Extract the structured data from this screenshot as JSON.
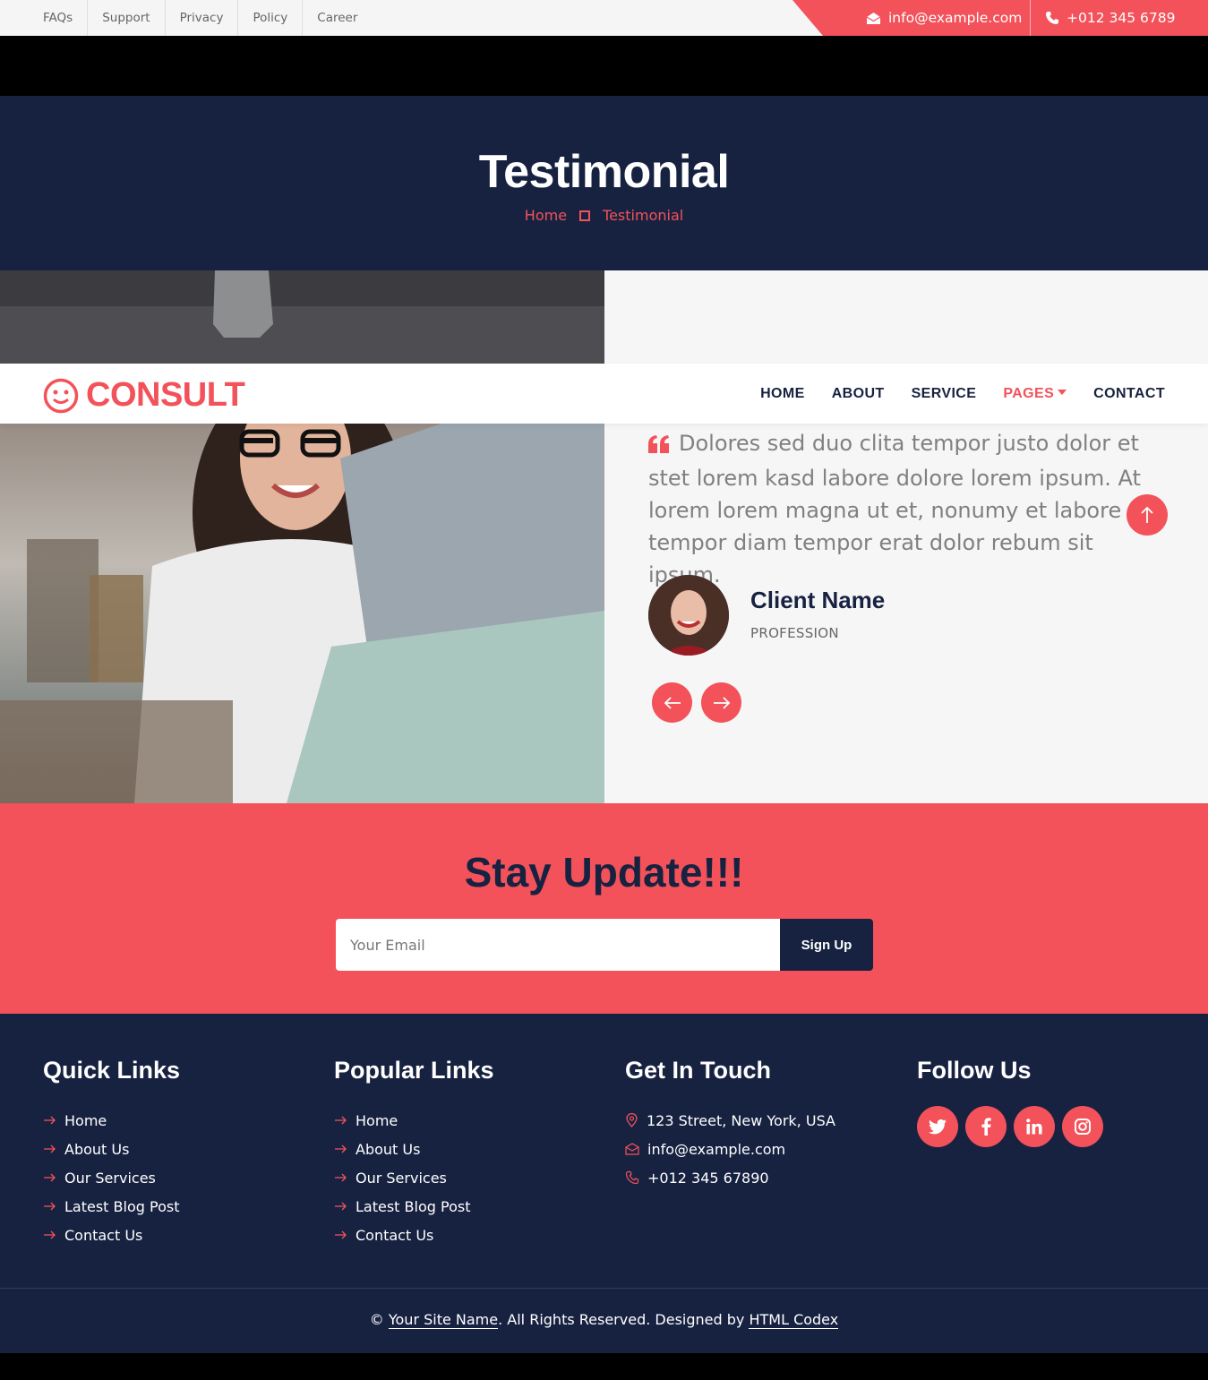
{
  "colors": {
    "accent": "#f3525a",
    "navy": "#172241",
    "light": "#f6f6f6"
  },
  "topbar": {
    "links": [
      "FAQs",
      "Support",
      "Privacy",
      "Policy",
      "Career"
    ],
    "email": "info@example.com",
    "phone": "+012 345 6789"
  },
  "hero": {
    "title": "Testimonial",
    "breadcrumb": [
      "Home",
      "Testimonial"
    ]
  },
  "navbar": {
    "brand": "CONSULT",
    "menu": [
      "HOME",
      "ABOUT",
      "SERVICE",
      "PAGES",
      "CONTACT"
    ],
    "active": "PAGES"
  },
  "testimonial": {
    "quote": "Dolores sed duo clita tempor justo dolor et stet lorem kasd labore dolore lorem ipsum. At lorem lorem magna ut et, nonumy et labore et tempor diam tempor erat dolor rebum sit ipsum.",
    "client_name": "Client Name",
    "profession": "PROFESSION"
  },
  "newsletter": {
    "title": "Stay Update!!!",
    "placeholder": "Your Email",
    "button": "Sign Up"
  },
  "footer": {
    "quick_links": {
      "title": "Quick Links",
      "items": [
        "Home",
        "About Us",
        "Our Services",
        "Latest Blog Post",
        "Contact Us"
      ]
    },
    "popular_links": {
      "title": "Popular Links",
      "items": [
        "Home",
        "About Us",
        "Our Services",
        "Latest Blog Post",
        "Contact Us"
      ]
    },
    "contact": {
      "title": "Get In Touch",
      "address": "123 Street, New York, USA",
      "email": "info@example.com",
      "phone": "+012 345 67890"
    },
    "follow": {
      "title": "Follow Us",
      "icons": [
        "twitter-icon",
        "facebook-icon",
        "linkedin-icon",
        "instagram-icon"
      ]
    },
    "copyright": {
      "prefix": "©",
      "site_name": "Your Site Name",
      "middle": ". All Rights Reserved. Designed by",
      "designer": "HTML Codex"
    }
  }
}
